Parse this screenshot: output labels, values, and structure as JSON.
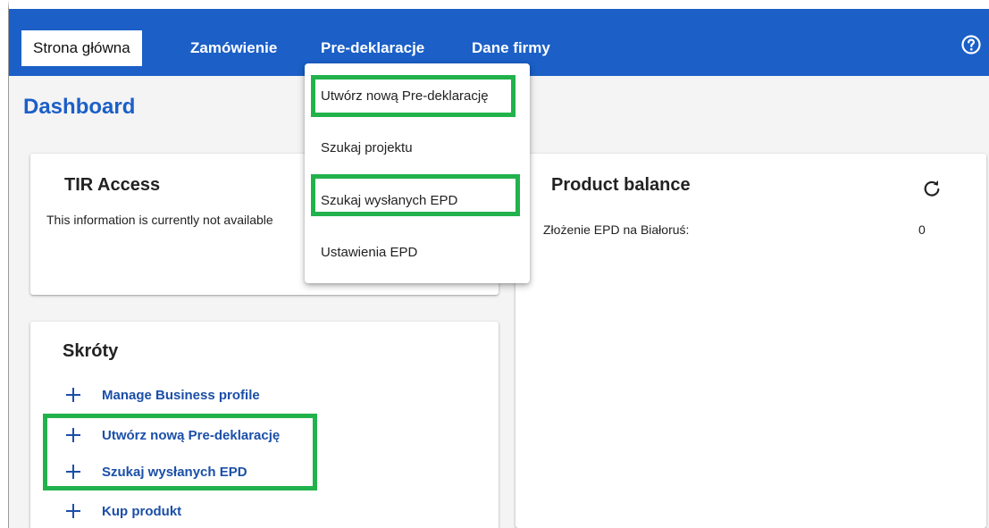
{
  "nav": {
    "tabs": [
      {
        "label": "Strona główna",
        "active": true
      },
      {
        "label": "Zamówienie",
        "active": false
      },
      {
        "label": "Pre-deklaracje",
        "active": false
      },
      {
        "label": "Dane firmy",
        "active": false
      }
    ],
    "help_icon": "help-circle-icon"
  },
  "page": {
    "title": "Dashboard"
  },
  "tir_access": {
    "title": "TIR Access",
    "message": "This information is currently not available"
  },
  "product_balance": {
    "title": "Product balance",
    "refresh_icon": "refresh-icon",
    "rows": [
      {
        "label": "Złożenie EPD na Białoruś:",
        "value": "0"
      }
    ]
  },
  "shortcuts": {
    "title": "Skróty",
    "items": [
      {
        "label": "Manage Business profile"
      },
      {
        "label": "Utwórz nową Pre-deklarację"
      },
      {
        "label": "Szukaj wysłanych EPD"
      },
      {
        "label": "Kup produkt"
      }
    ]
  },
  "dropdown": {
    "items": [
      {
        "label": "Utwórz nową Pre-deklarację"
      },
      {
        "label": "Szukaj projektu"
      },
      {
        "label": "Szukaj wysłanych EPD"
      },
      {
        "label": "Ustawienia EPD"
      }
    ]
  },
  "colors": {
    "nav_background": "#1b5fc7",
    "link": "#1b4fa8",
    "highlight": "#22b24c"
  }
}
